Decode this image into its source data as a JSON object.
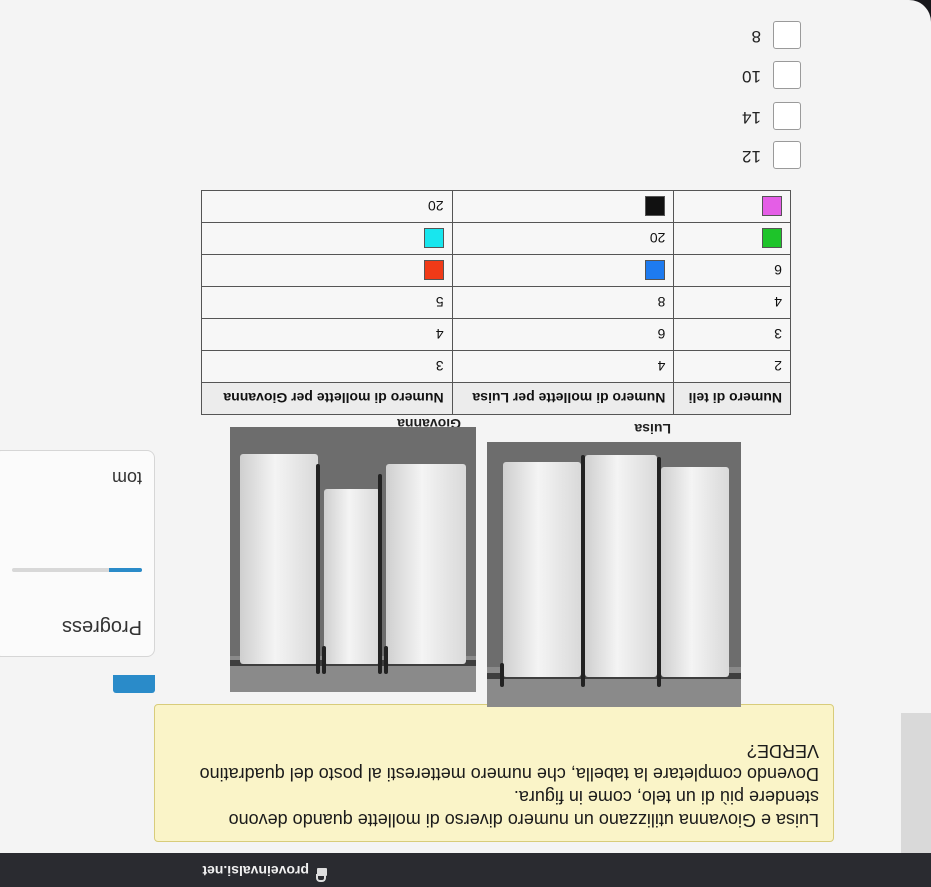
{
  "browser": {
    "site": "proveinvalsi.net"
  },
  "question": {
    "line1": "Luisa e Giovanna utilizzano un numero diverso di mollette quando devono",
    "line2": "stendere più di un telo, come in figura.",
    "line3": "Dovendo completare la tabella, che numero metteresti al posto del quadratino",
    "line4": "VERDE?"
  },
  "progress": {
    "label": "Progress",
    "label2": "tom",
    "fraction": 0.25,
    "accent": "#2a8bc9"
  },
  "figure": {
    "caption_giovanna": "Giovanna",
    "caption_luisa": "Luisa"
  },
  "table": {
    "headers": [
      "Numero di teli",
      "Numero di mollette per Luisa",
      "Numero di mollette per Giovanna"
    ],
    "rows": [
      [
        "2",
        "4",
        "3"
      ],
      [
        "3",
        "6",
        "4"
      ],
      [
        "4",
        "8",
        "5"
      ],
      [
        "6",
        {
          "swatch": "blue"
        },
        {
          "swatch": "red"
        }
      ],
      [
        {
          "swatch": "green"
        },
        "20",
        {
          "swatch": "cyan"
        }
      ],
      [
        {
          "swatch": "magenta"
        },
        {
          "swatch": "black"
        },
        "20"
      ]
    ],
    "swatch_colors": {
      "blue": "#1e7bf0",
      "red": "#f03a17",
      "green": "#1ec42a",
      "cyan": "#18e6ee",
      "magenta": "#e45ee6",
      "black": "#111111"
    }
  },
  "options": [
    "12",
    "14",
    "10",
    "8"
  ]
}
